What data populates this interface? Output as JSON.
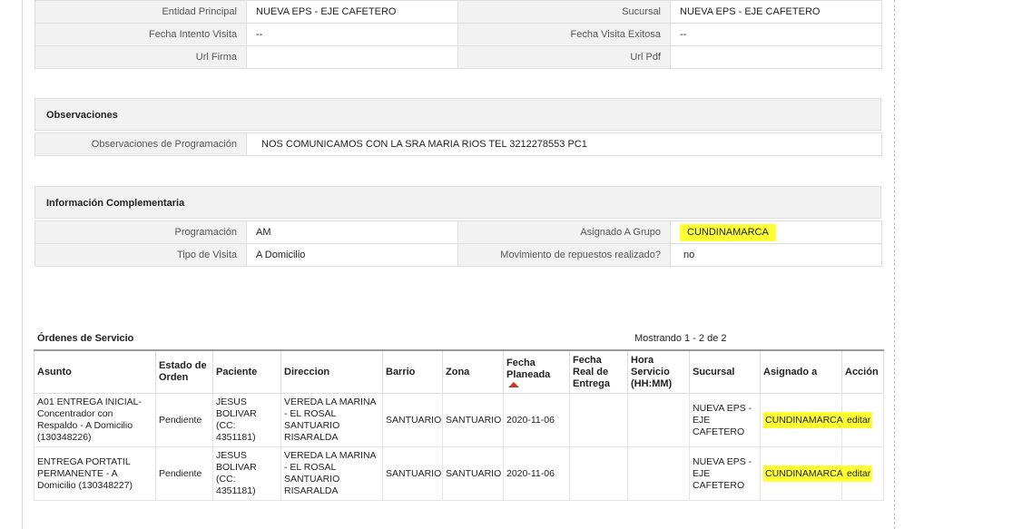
{
  "top_table": {
    "rows": [
      {
        "l1": "Entidad Principal",
        "v1": "NUEVA EPS - EJE CAFETERO",
        "l2": "Sucursal",
        "v2": "NUEVA EPS - EJE CAFETERO"
      },
      {
        "l1": "Fecha Intento Visita",
        "v1": "--",
        "l2": "Fecha Visita Exitosa",
        "v2": "--"
      },
      {
        "l1": "Url Firma",
        "v1": "",
        "l2": "Url Pdf",
        "v2": ""
      }
    ]
  },
  "observaciones": {
    "title": "Observaciones",
    "label": "Observaciones de Programación",
    "value": "NOS COMUNICAMOS CON LA SRA MARIA RIOS TEL 3212278553 PC1"
  },
  "info": {
    "title": "Información Complementaria",
    "programacion_label": "Programación",
    "programacion_value": "AM",
    "grupo_label": "Asignado A Grupo",
    "grupo_value": "CUNDINAMARCA",
    "tipo_label": "Tipo de Visita",
    "tipo_value": "A Domicilio",
    "mov_label": "Movimiento de repuestos realizado?",
    "mov_value": "no"
  },
  "orders": {
    "title": "Órdenes de Servicio",
    "showing": "Mostrando 1 - 2 de 2",
    "headers": {
      "asunto": "Asunto",
      "estado": "Estado de Orden",
      "paciente": "Paciente",
      "direccion": "Direccion",
      "barrio": "Barrio",
      "zona": "Zona",
      "fecha_planeada": "Fecha Planeada",
      "fecha_real": "Fecha Real de Entrega",
      "hora": "Hora Servicio (HH:MM)",
      "sucursal": "Sucursal",
      "asignado": "Asignado a",
      "accion": "Acción"
    },
    "rows": [
      {
        "asunto": "A01 ENTREGA INICIAL-Concentrador con Respaldo - A Domicilio (130348226)",
        "estado": "Pendiente",
        "paciente": "JESUS BOLIVAR (CC: 4351181)",
        "direccion": "VEREDA LA MARINA - EL ROSAL SANTUARIO RISARALDA",
        "barrio": "SANTUARIO",
        "zona": "SANTUARIO",
        "fecha_planeada": "2020-11-06",
        "fecha_real": "",
        "hora": "",
        "sucursal": "NUEVA EPS - EJE CAFETERO",
        "asignado": "CUNDINAMARCA",
        "accion": "editar"
      },
      {
        "asunto": "ENTREGA PORTATIL PERMANENTE - A Domicilio (130348227)",
        "estado": "Pendiente",
        "paciente": "JESUS BOLIVAR (CC: 4351181)",
        "direccion": "VEREDA LA MARINA - EL ROSAL SANTUARIO RISARALDA",
        "barrio": "SANTUARIO",
        "zona": "SANTUARIO",
        "fecha_planeada": "2020-11-06",
        "fecha_real": "",
        "hora": "",
        "sucursal": "NUEVA EPS - EJE CAFETERO",
        "asignado": "CUNDINAMARCA",
        "accion": "editar"
      }
    ]
  },
  "colors": {
    "highlight": "#ffff33",
    "label_bg": "#f2f2f2",
    "sort_arrow": "#c0392b"
  }
}
